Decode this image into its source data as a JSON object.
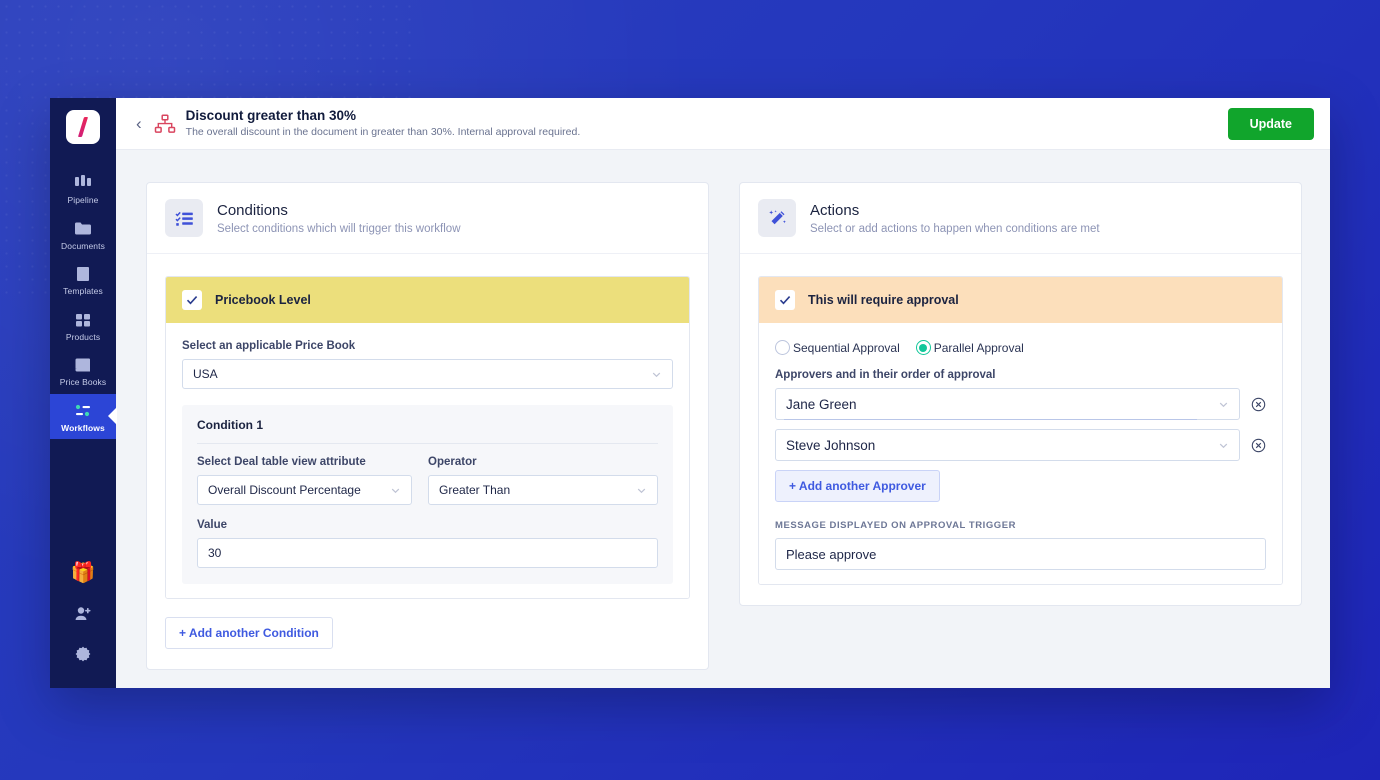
{
  "sidebar": {
    "logo_icon": "slash-logo",
    "items": [
      {
        "label": "Pipeline",
        "icon": "pipeline-icon",
        "active": false
      },
      {
        "label": "Documents",
        "icon": "documents-icon",
        "active": false
      },
      {
        "label": "Templates",
        "icon": "templates-icon",
        "active": false
      },
      {
        "label": "Products",
        "icon": "products-icon",
        "active": false
      },
      {
        "label": "Price Books",
        "icon": "pricebooks-icon",
        "active": false
      },
      {
        "label": "Workflows",
        "icon": "workflows-icon",
        "active": true
      }
    ],
    "bottom_items": [
      {
        "icon": "gift-icon"
      },
      {
        "icon": "add-user-icon"
      },
      {
        "icon": "gear-icon"
      }
    ]
  },
  "header": {
    "back_icon": "chevron-left-icon",
    "workflow_icon": "hierarchy-icon",
    "title": "Discount greater than 30%",
    "subtitle": "The overall discount in the document in greater than 30%. Internal approval required.",
    "update_label": "Update",
    "update_color": "#11a52c"
  },
  "conditions": {
    "icon": "checklist-icon",
    "title": "Conditions",
    "subtitle": "Select conditions which will trigger this workflow",
    "block": {
      "checked": true,
      "header_label": "Pricebook Level",
      "header_color": "#ecdf7c",
      "pricebook_label": "Select an applicable Price Book",
      "pricebook_value": "USA",
      "condition": {
        "title": "Condition 1",
        "attribute_label": "Select Deal table view attribute",
        "attribute_value": "Overall Discount Percentage",
        "operator_label": "Operator",
        "operator_value": "Greater Than",
        "value_label": "Value",
        "value_value": "30"
      }
    },
    "add_condition_label": "+ Add another Condition"
  },
  "actions": {
    "icon": "magic-wand-icon",
    "title": "Actions",
    "subtitle": "Select or add actions to happen when conditions are met",
    "block": {
      "checked": true,
      "header_label": "This will require approval",
      "header_color": "#fcdfbb",
      "approval_modes": [
        {
          "label": "Sequential Approval",
          "selected": false
        },
        {
          "label": "Parallel Approval",
          "selected": true
        }
      ],
      "selected_mode_color": "#12c79a",
      "approvers_label": "Approvers and in their order of approval",
      "approvers": [
        {
          "name": "Jane Green"
        },
        {
          "name": "Steve Johnson"
        }
      ],
      "add_approver_label": "+ Add another Approver",
      "message_label": "MESSAGE DISPLAYED ON APPROVAL TRIGGER",
      "message_value": "Please approve"
    }
  }
}
